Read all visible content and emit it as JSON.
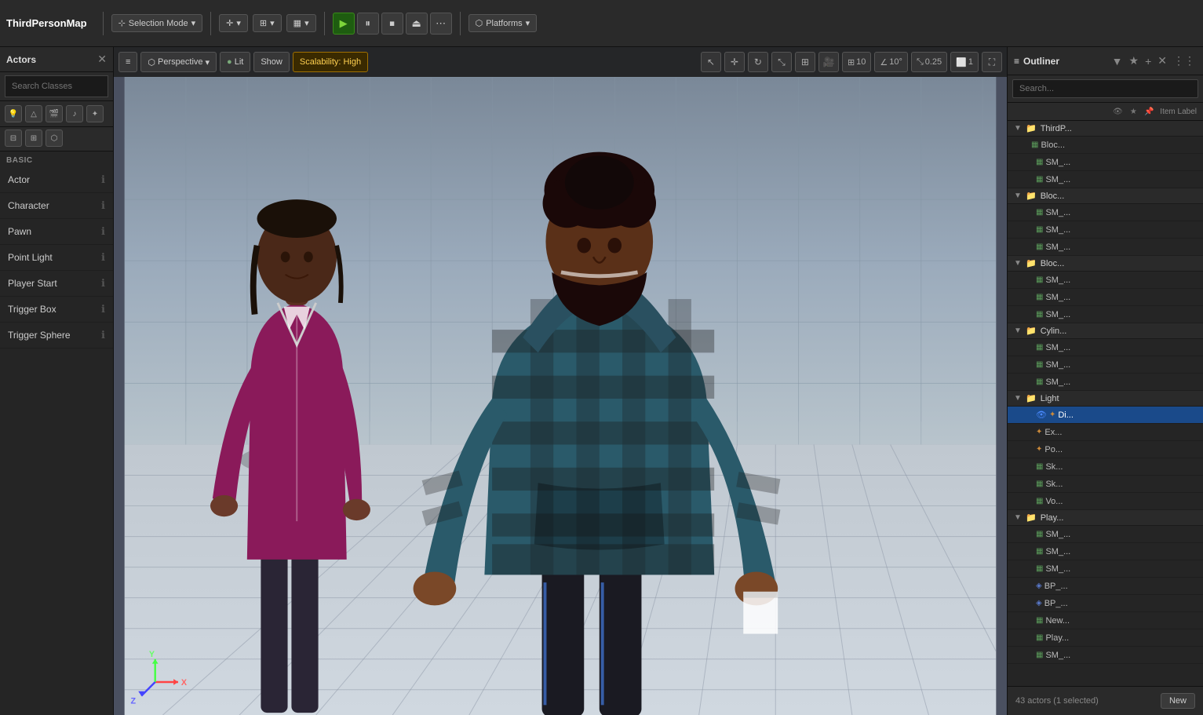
{
  "app": {
    "title": "ThirdPersonMap"
  },
  "toolbar": {
    "selection_mode_label": "Selection Mode",
    "platforms_label": "Platforms",
    "perspective_label": "Perspective",
    "lit_label": "Lit",
    "show_label": "Show",
    "scalability_label": "Scalability: High"
  },
  "viewport": {
    "perspective": "Perspective",
    "lit": "Lit",
    "show": "Show",
    "scalability": "Scalability: High",
    "grid_size": "10",
    "angle": "10°",
    "scale": "0.25",
    "grid_num": "1"
  },
  "left_panel": {
    "title": "Actors",
    "search_placeholder": "Search Classes",
    "section_label": "BASIC",
    "items": [
      {
        "label": "Actor",
        "has_info": true
      },
      {
        "label": "Character",
        "has_info": true
      },
      {
        "label": "Pawn",
        "has_info": true
      },
      {
        "label": "Point Light",
        "has_info": true
      },
      {
        "label": "Player Start",
        "has_info": true
      },
      {
        "label": "Trigger Box",
        "has_info": true
      },
      {
        "label": "Trigger Sphere",
        "has_info": true
      }
    ]
  },
  "right_panel": {
    "title": "Outliner",
    "search_placeholder": "Search...",
    "column_label": "Item Label",
    "status_text": "43 actors (1 selected)",
    "new_button_label": "New",
    "groups": [
      {
        "name": "ThirdP...",
        "icon": "folder",
        "expanded": true,
        "children": [
          {
            "name": "Bloc...",
            "icon": "mesh",
            "type": "mesh"
          },
          {
            "name": "SM_...",
            "icon": "mesh",
            "type": "mesh"
          },
          {
            "name": "SM_...",
            "icon": "mesh",
            "type": "mesh"
          }
        ]
      },
      {
        "name": "Bloc...",
        "icon": "folder",
        "expanded": true,
        "children": [
          {
            "name": "SM_...",
            "icon": "mesh",
            "type": "mesh"
          },
          {
            "name": "SM_...",
            "icon": "mesh",
            "type": "mesh"
          },
          {
            "name": "SM_...",
            "icon": "mesh",
            "type": "mesh"
          }
        ]
      },
      {
        "name": "Bloc...",
        "icon": "folder",
        "expanded": true,
        "children": [
          {
            "name": "SM_...",
            "icon": "mesh",
            "type": "mesh"
          },
          {
            "name": "SM_...",
            "icon": "mesh",
            "type": "mesh"
          },
          {
            "name": "SM_...",
            "icon": "mesh",
            "type": "mesh"
          }
        ]
      },
      {
        "name": "Cylin...",
        "icon": "folder",
        "expanded": true,
        "children": [
          {
            "name": "SM_...",
            "icon": "mesh",
            "type": "mesh"
          },
          {
            "name": "SM_...",
            "icon": "mesh",
            "type": "mesh"
          },
          {
            "name": "SM_...",
            "icon": "mesh",
            "type": "mesh"
          }
        ]
      },
      {
        "name": "Light",
        "icon": "folder",
        "expanded": true,
        "children": [
          {
            "name": "Di...",
            "icon": "light",
            "type": "light",
            "selected": true,
            "visible": true
          },
          {
            "name": "Ex...",
            "icon": "light",
            "type": "light"
          },
          {
            "name": "Po...",
            "icon": "light",
            "type": "light"
          },
          {
            "name": "Sk...",
            "icon": "mesh",
            "type": "mesh"
          },
          {
            "name": "Sk...",
            "icon": "mesh",
            "type": "mesh"
          },
          {
            "name": "Vo...",
            "icon": "mesh",
            "type": "mesh"
          }
        ]
      },
      {
        "name": "Play...",
        "icon": "folder",
        "expanded": true,
        "children": [
          {
            "name": "SM_...",
            "icon": "mesh",
            "type": "mesh"
          },
          {
            "name": "SM_...",
            "icon": "mesh",
            "type": "mesh"
          },
          {
            "name": "SM_...",
            "icon": "mesh",
            "type": "mesh"
          },
          {
            "name": "BP_...",
            "icon": "blueprint",
            "type": "blueprint"
          },
          {
            "name": "BP_...",
            "icon": "blueprint",
            "type": "blueprint"
          },
          {
            "name": "New...",
            "icon": "mesh",
            "type": "mesh"
          },
          {
            "name": "Play...",
            "icon": "mesh",
            "type": "mesh"
          },
          {
            "name": "SM_...",
            "icon": "mesh",
            "type": "mesh"
          }
        ]
      }
    ]
  },
  "icons": {
    "chevron_down": "▼",
    "chevron_right": "▶",
    "close": "✕",
    "search": "🔍",
    "eye": "👁",
    "folder": "📁",
    "mesh": "▦",
    "light": "✦",
    "blueprint": "◈",
    "info": "ℹ",
    "hamburger": "≡",
    "perspective_icon": "⬡",
    "play": "▶",
    "pause": "⏸",
    "stop": "⏹",
    "eject": "⏏"
  },
  "colors": {
    "accent_blue": "#1a4a8a",
    "selected_highlight": "#1a4a8a",
    "toolbar_bg": "#2a2a2a",
    "panel_bg": "#252525",
    "viewport_bg": "#4a5060"
  }
}
